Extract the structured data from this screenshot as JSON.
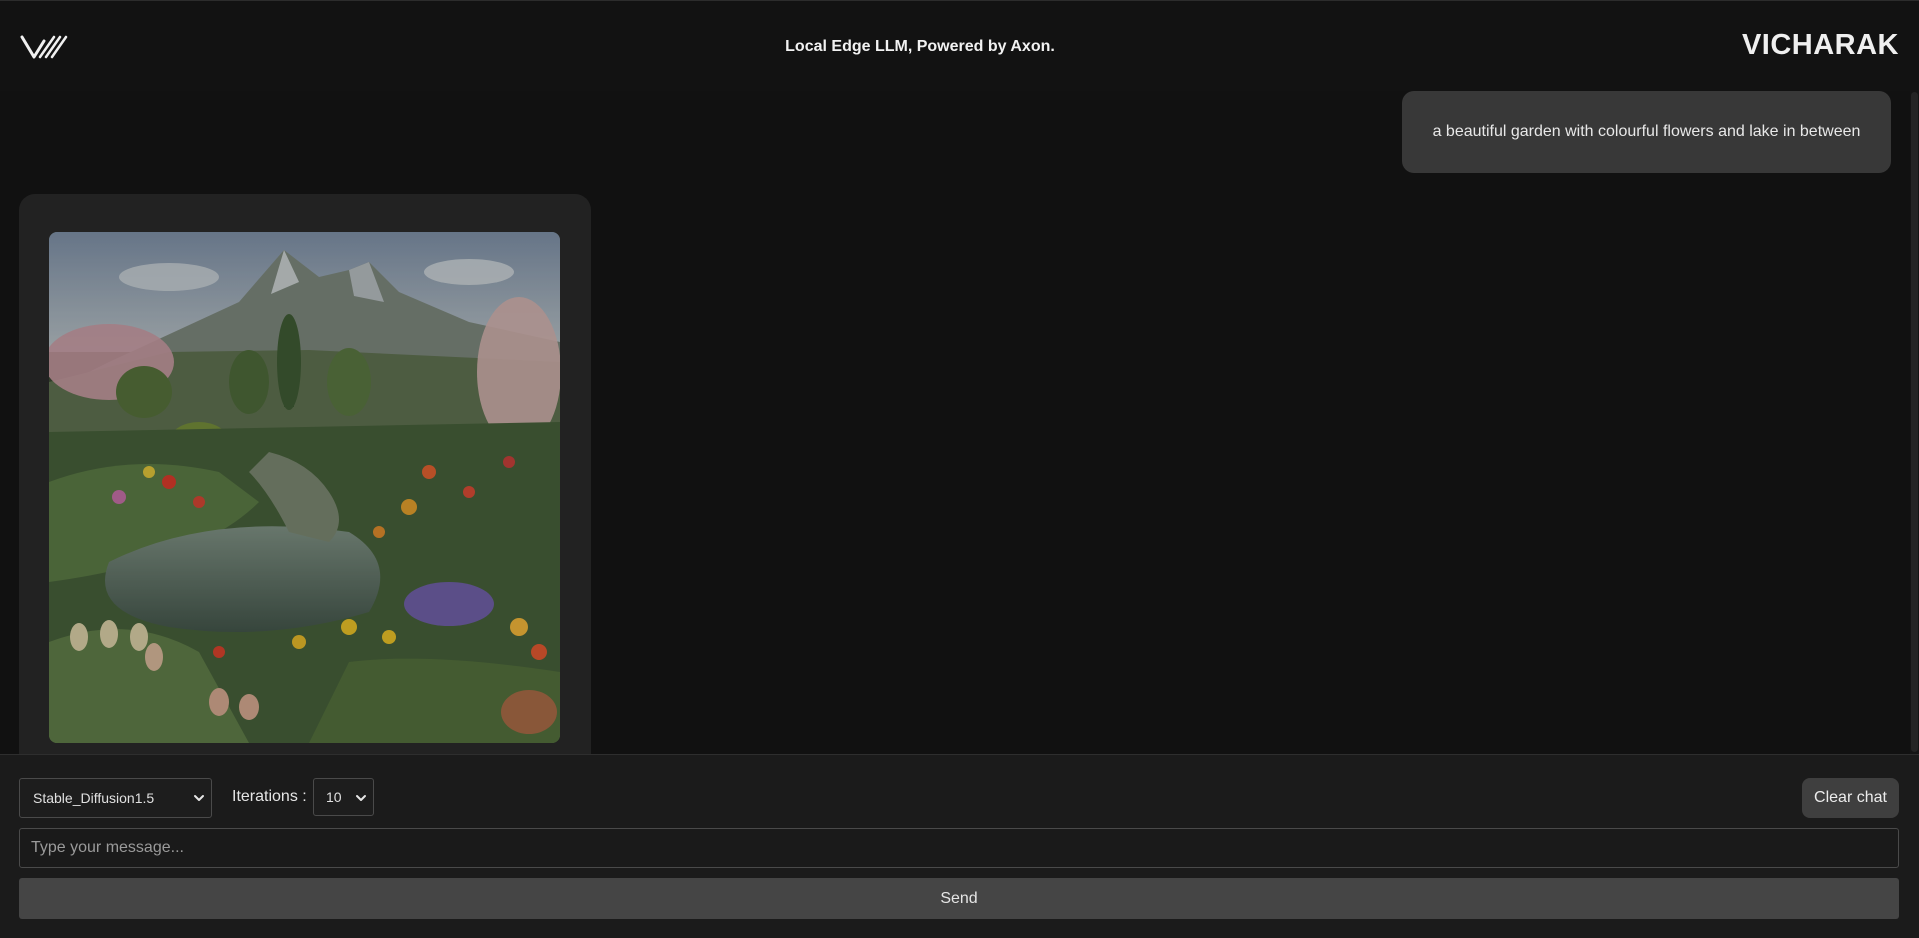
{
  "header": {
    "title": "Local Edge LLM, Powered by Axon.",
    "brand": "VICHARAK",
    "logo_icon": "vicharak-logo-icon"
  },
  "chat": {
    "messages": [
      {
        "role": "user",
        "text": "a beautiful garden with colourful flowers and lake in between"
      },
      {
        "role": "assistant",
        "content": "generated-image",
        "image_icon": "garden-image"
      }
    ]
  },
  "controls": {
    "model_select": {
      "selected": "Stable_Diffusion1.5",
      "icon": "chevron-down-icon"
    },
    "iterations": {
      "label": "Iterations :",
      "selected": "10",
      "icon": "chevron-down-icon"
    },
    "clear_label": "Clear chat",
    "input_placeholder": "Type your message...",
    "input_value": "",
    "send_label": "Send"
  },
  "colors": {
    "background": "#111111",
    "panel": "#1b1b1b",
    "user_bubble": "#383838",
    "bot_card": "#222222",
    "button": "#454545"
  }
}
